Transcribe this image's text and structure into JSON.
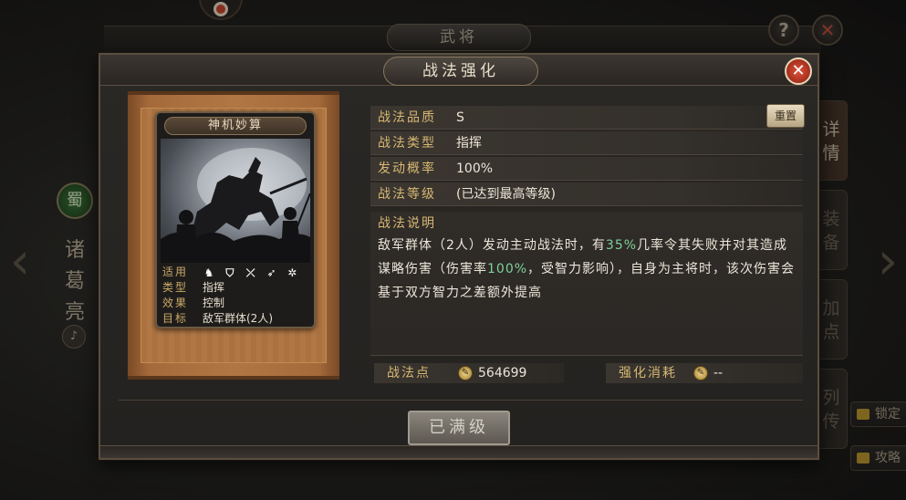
{
  "background": {
    "header_title": "武将",
    "hero_faction": "蜀",
    "hero_name": [
      "诸",
      "葛",
      "亮"
    ],
    "right_tabs": [
      {
        "label": "详情",
        "active": true
      },
      {
        "label": "装备",
        "active": false
      },
      {
        "label": "加点",
        "active": false
      },
      {
        "label": "列传",
        "active": false
      }
    ],
    "side_buttons": {
      "lock": "锁定",
      "guide": "攻略"
    },
    "help_glyph": "?",
    "close_glyph": "✕"
  },
  "dialog": {
    "title": "战法强化",
    "close_glyph": "✕",
    "reset_label": "重置",
    "fields": [
      {
        "label": "战法品质",
        "value": "S"
      },
      {
        "label": "战法类型",
        "value": "指挥"
      },
      {
        "label": "发动概率",
        "value": "100%"
      },
      {
        "label": "战法等级",
        "value": "(已达到最高等级)"
      }
    ],
    "description": {
      "label": "战法说明",
      "parts": [
        {
          "text": "敌军群体（2人）发动主动战法时，有",
          "highlight": false
        },
        {
          "text": "35%",
          "highlight": true
        },
        {
          "text": "几率令其失败并对其造成谋略伤害（伤害率",
          "highlight": false
        },
        {
          "text": "100%",
          "highlight": true
        },
        {
          "text": "，受智力影响），自身为主将时，该次伤害会基于双方智力之差额外提高",
          "highlight": false
        }
      ]
    },
    "points": {
      "label": "战法点",
      "value": "564699"
    },
    "cost": {
      "label": "强化消耗",
      "value": "--"
    },
    "max_button": "已满级"
  },
  "card": {
    "name": "神机妙算",
    "rows": [
      {
        "key": "适用",
        "value": ""
      },
      {
        "key": "类型",
        "value": "指挥"
      },
      {
        "key": "效果",
        "value": "控制"
      },
      {
        "key": "目标",
        "value": "敌军群体(2人)"
      }
    ],
    "unit_icons": [
      "cavalry-icon",
      "shield-icon",
      "bow-icon",
      "spear-icon",
      "siege-icon"
    ]
  },
  "colors": {
    "label_gold": "#d7b874",
    "highlight_green": "#7fd29a",
    "close_red": "#c8452e"
  }
}
